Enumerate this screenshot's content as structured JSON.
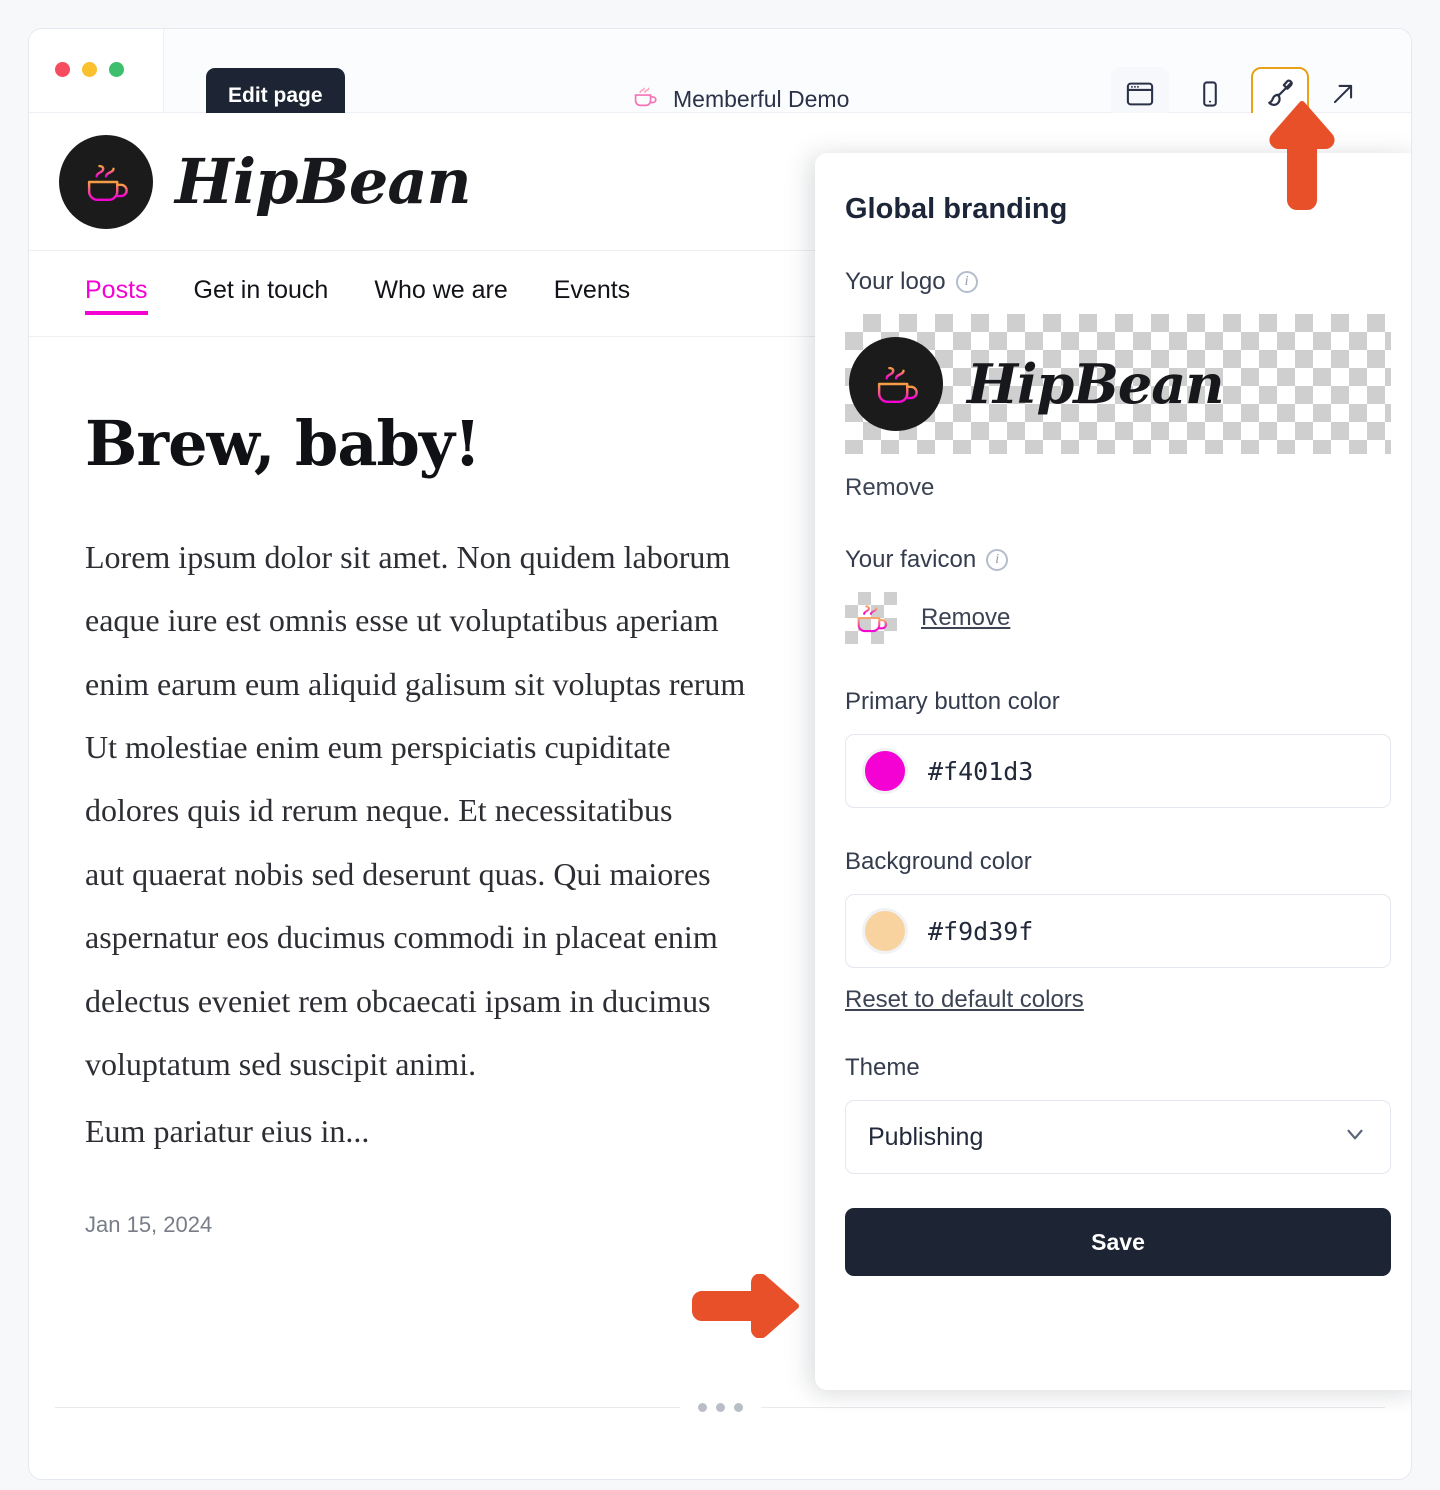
{
  "browser": {
    "edit_page_label": "Edit page",
    "site_title": "Memberful Demo",
    "toolbar_icons": [
      {
        "name": "desktop-view-icon",
        "label": "Desktop view"
      },
      {
        "name": "mobile-view-icon",
        "label": "Mobile view"
      },
      {
        "name": "brush-branding-icon",
        "label": "Branding"
      },
      {
        "name": "open-external-icon",
        "label": "Open in new tab"
      }
    ]
  },
  "site": {
    "brand_name": "HipBean",
    "nav": [
      {
        "label": "Posts",
        "active": true
      },
      {
        "label": "Get in touch",
        "active": false
      },
      {
        "label": "Who we are",
        "active": false
      },
      {
        "label": "Events",
        "active": false
      }
    ],
    "post": {
      "title": "Brew, baby!",
      "lines": [
        "Lorem ipsum dolor sit amet. Non quidem laborum",
        "eaque iure est omnis esse ut voluptatibus aperiam",
        "enim earum eum aliquid galisum sit voluptas rerum",
        "Ut molestiae enim eum perspiciatis cupiditate",
        "dolores quis id rerum neque. Et necessitatibus",
        "aut quaerat nobis sed deserunt quas. Qui maiores",
        "aspernatur eos ducimus commodi in placeat enim",
        "delectus eveniet rem obcaecati ipsam in ducimus",
        "voluptatum sed suscipit animi."
      ],
      "tail": "Eum pariatur eius in...",
      "date": "Jan 15, 2024"
    }
  },
  "panel": {
    "heading": "Global branding",
    "logo_label": "Your logo",
    "logo_remove": "Remove",
    "favicon_label": "Your favicon",
    "favicon_remove": "Remove",
    "primary_color_label": "Primary button color",
    "primary_color_value": "#f401d3",
    "background_color_label": "Background color",
    "background_color_value": "#f9d39f",
    "reset_link": "Reset to default colors",
    "theme_label": "Theme",
    "theme_value": "Publishing",
    "save_label": "Save"
  },
  "colors": {
    "primary_button": "#f401d3",
    "background": "#f9d39f",
    "nav_active": "#f401d3",
    "dark": "#1d2433",
    "annotation_arrow": "#e8502a",
    "active_ring": "#eaa018"
  }
}
